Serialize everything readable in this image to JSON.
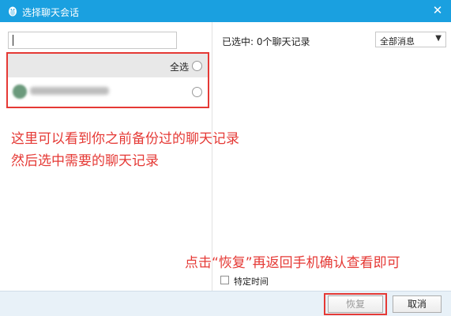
{
  "window": {
    "title": "选择聊天会话",
    "close_label": "✕"
  },
  "left_panel": {
    "search": {
      "value": "",
      "placeholder": ""
    },
    "select_all_label": "全选"
  },
  "right_panel": {
    "selected_count": "已选中: 0个聊天记录",
    "filter": {
      "selected": "全部消息",
      "arrow": "▼"
    },
    "specific_time_label": "特定时间"
  },
  "annotations": {
    "line1": "这里可以看到你之前备份过的聊天记录",
    "line2": "然后选中需要的聊天记录",
    "line3": "点击“恢复”再返回手机确认查看即可"
  },
  "buttons": {
    "restore": "恢复",
    "cancel": "取消"
  },
  "colors": {
    "titlebar": "#1aa0e0",
    "highlight": "#e53935"
  }
}
